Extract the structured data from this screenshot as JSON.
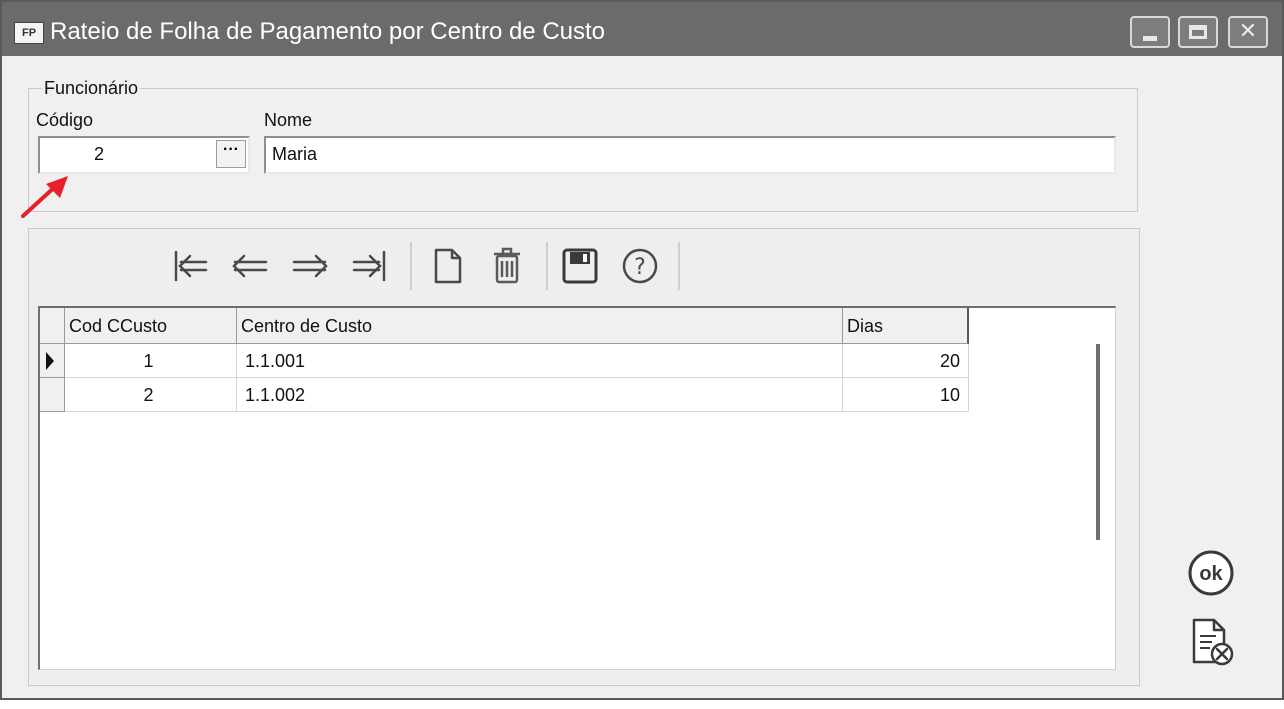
{
  "window": {
    "app_icon_text": "FP",
    "title": "Rateio de Folha de Pagamento por Centro de Custo"
  },
  "employee": {
    "group_title": "Funcionário",
    "code_label": "Código",
    "code_value": "2",
    "lookup_label": "···",
    "name_label": "Nome",
    "name_value": "Maria"
  },
  "toolbar": {
    "buttons": [
      "first-record-icon",
      "previous-record-icon",
      "next-record-icon",
      "last-record-icon",
      "new-document-icon",
      "delete-trash-icon",
      "save-floppy-icon",
      "help-question-icon"
    ]
  },
  "table": {
    "columns": [
      "Cod CCusto",
      "Centro de Custo",
      "Dias"
    ],
    "rows": [
      {
        "cod": "1",
        "centro": "1.1.001",
        "dias": "20"
      },
      {
        "cod": "2",
        "centro": "1.1.002",
        "dias": "10"
      }
    ]
  },
  "side_buttons": {
    "ok_label": "ok",
    "cancel_icon": "document-cancel-icon"
  },
  "colors": {
    "titlebar": "#6b6b6b",
    "annotation_arrow": "#e8202a"
  }
}
